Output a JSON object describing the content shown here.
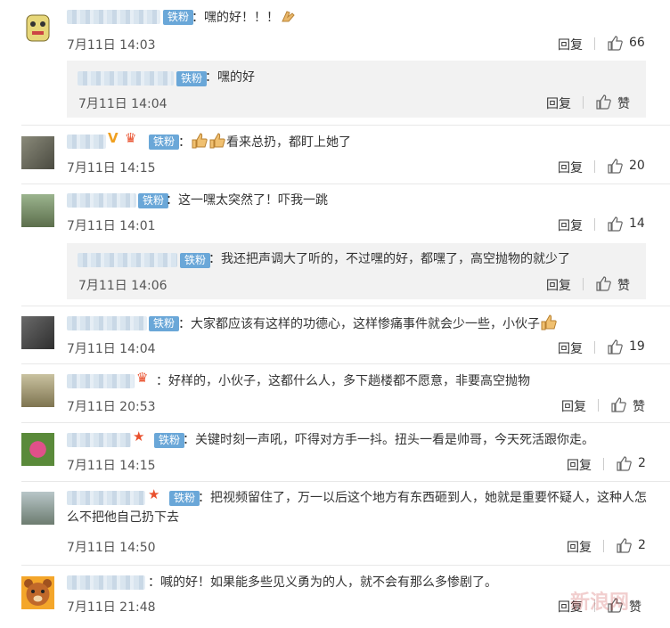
{
  "fan_badge": "铁粉",
  "reply_label": "回复",
  "like_label": "赞",
  "comments": [
    {
      "text": "：嘿的好！！！",
      "time": "7月11日 14:03",
      "likes": "66"
    },
    {
      "text": "：嘿的好",
      "time": "7月11日 14:04",
      "likes": "赞"
    },
    {
      "text": "看来总扔，都盯上她了",
      "time": "7月11日 14:15",
      "likes": "20"
    },
    {
      "text": "：这一嘿太突然了！吓我一跳",
      "time": "7月11日 14:01",
      "likes": "14"
    },
    {
      "text": "：我还把声调大了听的，不过嘿的好，都嘿了，高空抛物的就少了",
      "time": "7月11日 14:06",
      "likes": "赞"
    },
    {
      "text": "：大家都应该有这样的功德心，这样惨痛事件就会少一些，小伙子",
      "time": "7月11日 14:04",
      "likes": "19"
    },
    {
      "text": "：好样的，小伙子，这都什么人，多下趟楼都不愿意，非要高空抛物",
      "time": "7月11日 20:53",
      "likes": "赞"
    },
    {
      "text": "：关键时刻一声吼，吓得对方手一抖。扭头一看是帅哥，今天死活跟你走。",
      "time": "7月11日 14:15",
      "likes": "2"
    },
    {
      "text": "：把视频留住了，万一以后这个地方有东西砸到人，她就是重要怀疑人，这种人怎么不把他自己扔下去",
      "time": "7月11日 14:50",
      "likes": "2"
    },
    {
      "text": "：喊的好！如果能多些见义勇为的人，就不会有那么多惨剧了。",
      "time": "7月11日 21:48",
      "likes": "赞"
    }
  ],
  "watermark": "新浪网"
}
